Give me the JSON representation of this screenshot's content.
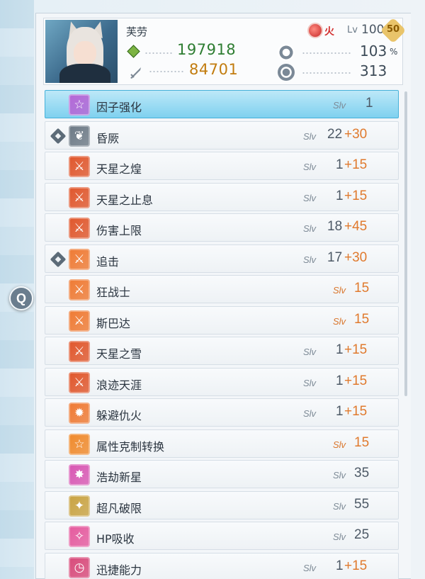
{
  "colors": {
    "selected_row": "#7fd1ef",
    "hp": "#2e7d32",
    "atk": "#c27c0e",
    "bonus": "#e07a2e",
    "element_fire": "#d32f2f"
  },
  "side_button": {
    "label": "Q"
  },
  "character": {
    "name": "芙劳",
    "element_label": "火",
    "level_prefix": "Lv",
    "level": "100",
    "level_badge": "50",
    "hp": "197918",
    "atk": "84701",
    "crit": "103",
    "crit_unit": "%",
    "speed": "313"
  },
  "skills": [
    {
      "name": "因子强化",
      "slv": "Slv",
      "level": "1",
      "bonus": "",
      "icon": "star-icon",
      "icon_color": "#b467d6",
      "icon_glyph": "☆",
      "pinned": false,
      "selected": true,
      "orange_level": false
    },
    {
      "name": "昏厥",
      "slv": "Slv",
      "level": "22",
      "bonus": "+30",
      "icon": "dragon-icon",
      "icon_color": "#6d7a86",
      "icon_glyph": "❦",
      "pinned": true,
      "selected": false,
      "orange_level": false
    },
    {
      "name": "天星之煌",
      "slv": "Slv",
      "level": "1",
      "bonus": "+15",
      "icon": "sword-icon",
      "icon_color": "#e0562b",
      "icon_glyph": "⚔",
      "pinned": false,
      "selected": false,
      "orange_level": false
    },
    {
      "name": "天星之止息",
      "slv": "Slv",
      "level": "1",
      "bonus": "+15",
      "icon": "sword-icon",
      "icon_color": "#e0562b",
      "icon_glyph": "⚔",
      "pinned": false,
      "selected": false,
      "orange_level": false
    },
    {
      "name": "伤害上限",
      "slv": "Slv",
      "level": "18",
      "bonus": "+45",
      "icon": "sword-icon",
      "icon_color": "#e0562b",
      "icon_glyph": "⚔",
      "pinned": false,
      "selected": false,
      "orange_level": false
    },
    {
      "name": "追击",
      "slv": "Slv",
      "level": "17",
      "bonus": "+30",
      "icon": "sword-icon",
      "icon_color": "#ef7a33",
      "icon_glyph": "⚔",
      "pinned": true,
      "selected": false,
      "orange_level": false
    },
    {
      "name": "狂战士",
      "slv": "Slv",
      "level": "15",
      "bonus": "",
      "icon": "sword-icon",
      "icon_color": "#ef7a33",
      "icon_glyph": "⚔",
      "pinned": false,
      "selected": false,
      "orange_level": true
    },
    {
      "name": "斯巴达",
      "slv": "Slv",
      "level": "15",
      "bonus": "",
      "icon": "sword-icon",
      "icon_color": "#ef7a33",
      "icon_glyph": "⚔",
      "pinned": false,
      "selected": false,
      "orange_level": true
    },
    {
      "name": "天星之雪",
      "slv": "Slv",
      "level": "1",
      "bonus": "+15",
      "icon": "sword-icon",
      "icon_color": "#e0562b",
      "icon_glyph": "⚔",
      "pinned": false,
      "selected": false,
      "orange_level": false
    },
    {
      "name": "浪迹天涯",
      "slv": "Slv",
      "level": "1",
      "bonus": "+15",
      "icon": "sword-icon",
      "icon_color": "#e0562b",
      "icon_glyph": "⚔",
      "pinned": false,
      "selected": false,
      "orange_level": false
    },
    {
      "name": "躲避仇火",
      "slv": "Slv",
      "level": "1",
      "bonus": "+15",
      "icon": "gear-icon",
      "icon_color": "#ef7a33",
      "icon_glyph": "✹",
      "pinned": false,
      "selected": false,
      "orange_level": false
    },
    {
      "name": "属性克制转换",
      "slv": "Slv",
      "level": "15",
      "bonus": "",
      "icon": "star-icon",
      "icon_color": "#f08a2c",
      "icon_glyph": "☆",
      "pinned": false,
      "selected": false,
      "orange_level": true
    },
    {
      "name": "浩劫新星",
      "slv": "Slv",
      "level": "35",
      "bonus": "",
      "icon": "burst-icon",
      "icon_color": "#d857b3",
      "icon_glyph": "✸",
      "pinned": false,
      "selected": false,
      "orange_level": false
    },
    {
      "name": "超凡破限",
      "slv": "Slv",
      "level": "55",
      "bonus": "",
      "icon": "break-icon",
      "icon_color": "#c9a342",
      "icon_glyph": "✦",
      "pinned": false,
      "selected": false,
      "orange_level": false
    },
    {
      "name": "HP吸收",
      "slv": "Slv",
      "level": "25",
      "bonus": "",
      "icon": "sparkle-icon",
      "icon_color": "#e55a9e",
      "icon_glyph": "✧",
      "pinned": false,
      "selected": false,
      "orange_level": false
    },
    {
      "name": "迅捷能力",
      "slv": "Slv",
      "level": "1",
      "bonus": "+15",
      "icon": "clock-icon",
      "icon_color": "#d84a7a",
      "icon_glyph": "◷",
      "pinned": false,
      "selected": false,
      "orange_level": false
    }
  ]
}
